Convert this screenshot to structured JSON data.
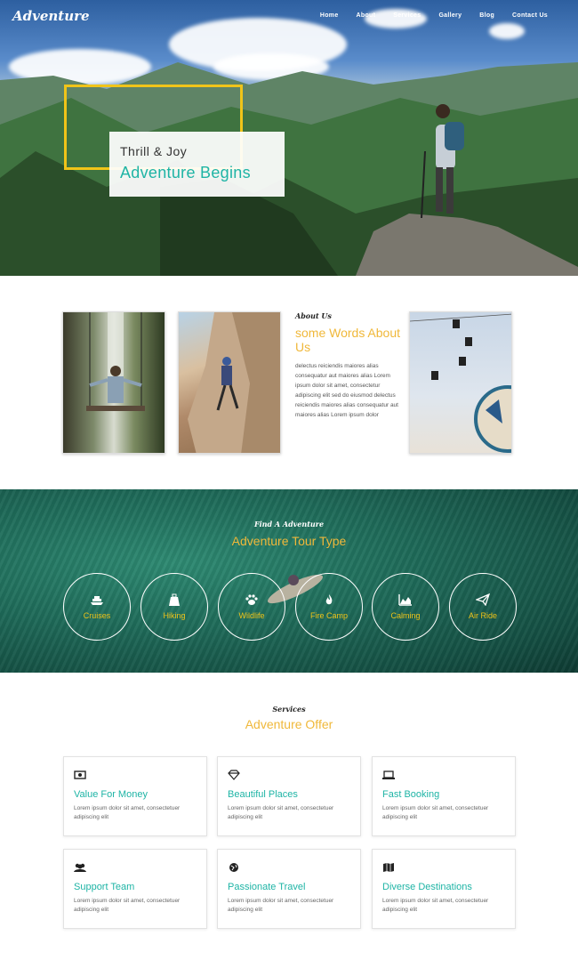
{
  "header": {
    "logo": "Adventure",
    "nav": [
      "Home",
      "About",
      "Services",
      "Gallery",
      "Blog",
      "Contact Us"
    ],
    "active_nav": "Home"
  },
  "hero": {
    "line1": "Thrill & Joy",
    "line2": "Adventure Begins"
  },
  "about": {
    "label": "About Us",
    "heading": "some Words About Us",
    "body": "delectus reiciendis maiores alias consequatur aut maiores alias Lorem ipsum dolor sit amet, consectetur adipiscing elit sed do eiusmod delectus reiciendis maiores alias consequatur aut maiores alias Lorem ipsum dolor"
  },
  "tours": {
    "label": "Find A Adventure",
    "heading": "Adventure Tour Type",
    "items": [
      {
        "name": "Cruises",
        "icon": "ship-icon"
      },
      {
        "name": "Hiking",
        "icon": "backpack-icon"
      },
      {
        "name": "Wildlife",
        "icon": "paw-icon"
      },
      {
        "name": "Fire Camp",
        "icon": "fire-icon"
      },
      {
        "name": "Calming",
        "icon": "area-chart-icon"
      },
      {
        "name": "Air Ride",
        "icon": "paper-plane-icon"
      }
    ]
  },
  "services": {
    "label": "Services",
    "heading": "Adventure Offer",
    "items": [
      {
        "title": "Value For Money",
        "desc": "Lorem ipsum dolor sit amet, consectetuer adipiscing elit",
        "icon": "money-icon"
      },
      {
        "title": "Beautiful Places",
        "desc": "Lorem ipsum dolor sit amet, consectetuer adipiscing elit",
        "icon": "diamond-icon"
      },
      {
        "title": "Fast Booking",
        "desc": "Lorem ipsum dolor sit amet, consectetuer adipiscing elit",
        "icon": "laptop-icon"
      },
      {
        "title": "Support Team",
        "desc": "Lorem ipsum dolor sit amet, consectetuer adipiscing elit",
        "icon": "users-icon"
      },
      {
        "title": "Passionate Travel",
        "desc": "Lorem ipsum dolor sit amet, consectetuer adipiscing elit",
        "icon": "globe-icon"
      },
      {
        "title": "Diverse Destinations",
        "desc": "Lorem ipsum dolor sit amet, consectetuer adipiscing elit",
        "icon": "map-icon"
      }
    ]
  },
  "colors": {
    "accent_gold": "#f0b83a",
    "accent_teal": "#1eb4a5",
    "frame_yellow": "#f0c419"
  }
}
